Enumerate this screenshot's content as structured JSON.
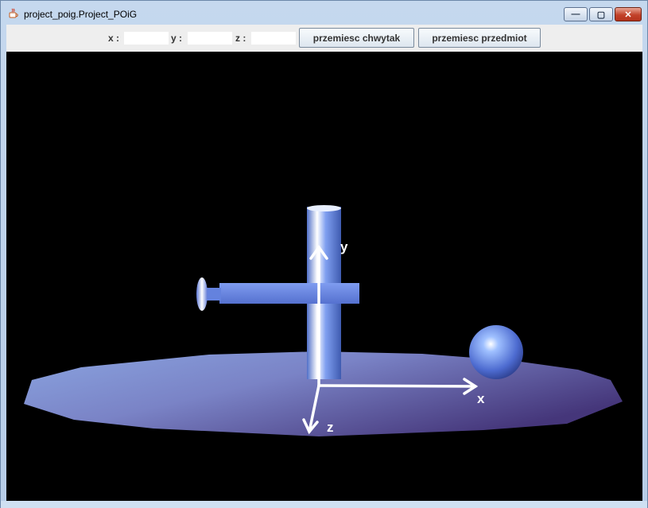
{
  "window": {
    "title": "project_poig.Project_POiG",
    "controls": {
      "minimize": "—",
      "maximize": "▢",
      "close": "✕"
    }
  },
  "toolbar": {
    "x_label": "x :",
    "x_value": "",
    "y_label": "y :",
    "y_value": "",
    "z_label": "z :",
    "z_value": "",
    "move_gripper_button": "przemiesc chwytak",
    "move_object_button": "przemiesc przedmiot"
  },
  "scene": {
    "background": "#000000",
    "object_color": "#6f8fe8",
    "platform_color": "#6470b0",
    "axis_color": "#ffffff",
    "axis_labels": {
      "x": "x",
      "y": "y",
      "z": "z"
    }
  }
}
